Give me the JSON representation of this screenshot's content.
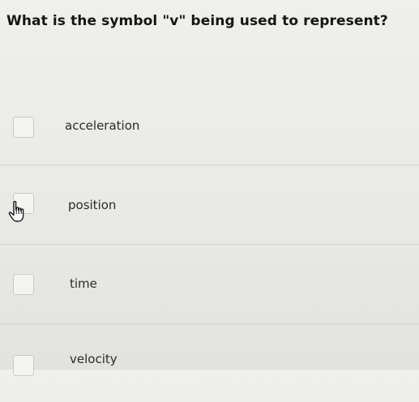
{
  "question": {
    "text": "What is the symbol \"v\" being used to represent?"
  },
  "options": [
    {
      "label": "acceleration",
      "checked": false
    },
    {
      "label": "position",
      "checked": false
    },
    {
      "label": "time",
      "checked": false
    },
    {
      "label": "velocity",
      "checked": false
    }
  ],
  "cursor": {
    "icon": "hand-pointer-icon"
  }
}
